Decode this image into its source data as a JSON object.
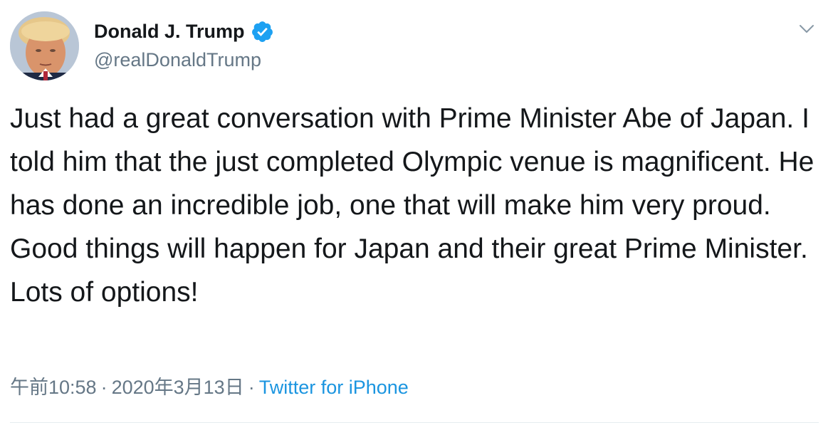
{
  "tweet": {
    "author": {
      "display_name": "Donald J. Trump",
      "handle": "@realDonaldTrump",
      "verified": true,
      "avatar_icon": "profile-avatar"
    },
    "more_icon": "chevron-down-icon",
    "text": "Just had a great conversation with Prime Minister Abe of Japan. I told him that the just completed Olympic venue is magnificent. He has done an incredible job, one that will make him very proud. Good things will happen for Japan and their great Prime Minister. Lots of options!",
    "meta": {
      "time": "午前10:58",
      "separator": "·",
      "date": "2020年3月13日",
      "source": "Twitter for iPhone"
    }
  },
  "colors": {
    "text": "#14171a",
    "secondary": "#657786",
    "link": "#1b95e0",
    "verified_badge": "#1da1f2",
    "divider": "#e6ecf0"
  }
}
